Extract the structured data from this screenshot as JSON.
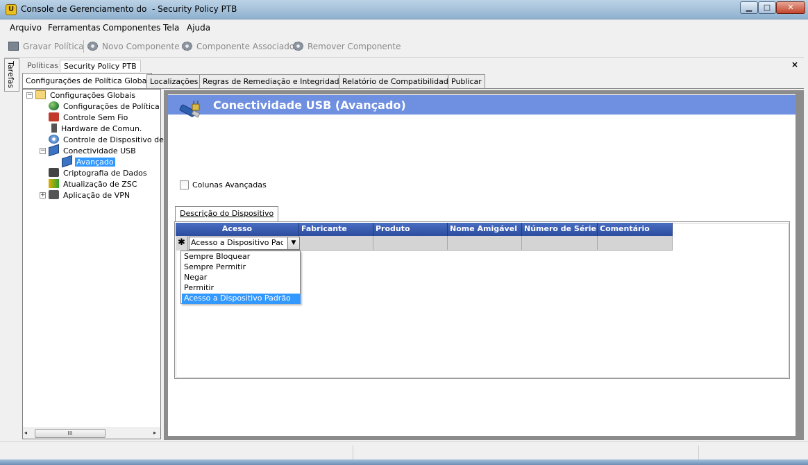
{
  "window": {
    "title": "Console de Gerenciamento do  - Security Policy PTB",
    "minimize": "▁",
    "maximize": "□",
    "close": "✕"
  },
  "menu": [
    "Arquivo",
    "Ferramentas",
    "Componentes",
    "Tela",
    "Ajuda"
  ],
  "toolbar": {
    "save": "Gravar Política",
    "new_component": "Novo Componente",
    "associated_component": "Componente Associado",
    "remove_component": "Remover Componente"
  },
  "side_strip": {
    "tasks": "Tarefas"
  },
  "doc_tabs": {
    "policies": "Políticas",
    "current": "Security Policy PTB",
    "close": "×"
  },
  "tabs": [
    "Configurações de Política Global",
    "Localizações",
    "Regras de Remediação e Integridade",
    "Relatório de Compatibilidade",
    "Publicar"
  ],
  "tree": {
    "root": "Configurações Globais",
    "items": [
      {
        "label": "Configurações de Política",
        "icon": "globe-icon"
      },
      {
        "label": "Controle Sem Fio",
        "icon": "wireless-icon"
      },
      {
        "label": "Hardware de Comun.",
        "icon": "hardware-icon"
      },
      {
        "label": "Controle de Dispositivo de",
        "icon": "disk-icon"
      },
      {
        "label": "Conectividade USB",
        "icon": "usb-icon"
      },
      {
        "label": "Avançado",
        "icon": "usb-icon"
      },
      {
        "label": "Criptografia de Dados",
        "icon": "crypto-icon"
      },
      {
        "label": "Atualização de ZSC",
        "icon": "update-icon"
      },
      {
        "label": "Aplicação de VPN",
        "icon": "vpn-icon"
      }
    ],
    "scroll_thumb": "III"
  },
  "content": {
    "header_title": "Conectividade USB (Avançado)",
    "advanced_columns_label": "Colunas Avançadas",
    "advanced_columns_checked": false,
    "device_tab": "Descrição do Dispositivo"
  },
  "grid": {
    "columns": [
      "Acesso",
      "Fabricante",
      "Produto",
      "Nome Amigável",
      "Número de Série",
      "Comentário"
    ],
    "row_marker": "✱",
    "row": {
      "acesso": "Acesso a Dispositivo Padr",
      "fabricante": "",
      "produto": "",
      "nome_amigavel": "",
      "numero_serie": "",
      "comentario": ""
    }
  },
  "dropdown": {
    "options": [
      "Sempre Bloquear",
      "Sempre Permitir",
      "Negar",
      "Permitir",
      "Acesso a Dispositivo Padrão"
    ],
    "selected": "Acesso a Dispositivo Padrão"
  },
  "colors": {
    "header_band": "#6f8fe0",
    "grid_header": "#2c4c9f",
    "selection": "#3399ff"
  }
}
